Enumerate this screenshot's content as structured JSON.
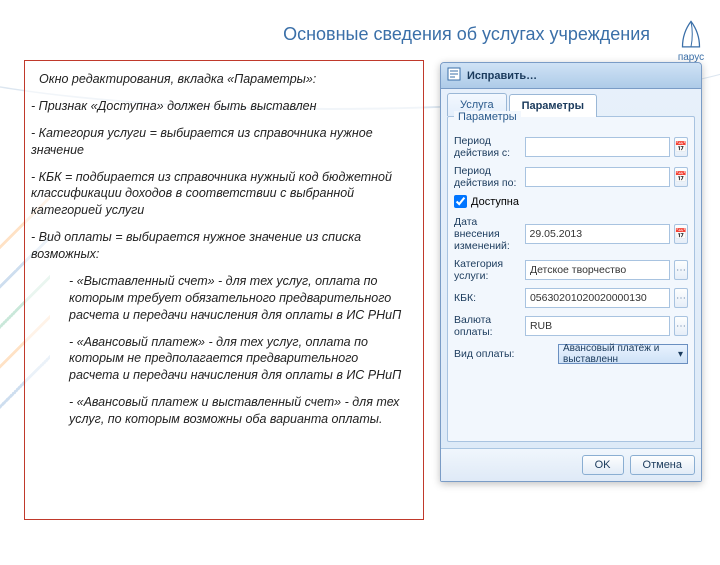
{
  "page": {
    "title": "Основные сведения об услугах учреждения"
  },
  "logo": {
    "text": "парус"
  },
  "instructions": {
    "intro": "Окно редактирования, вкладка «Параметры»:",
    "i1": "Признак «Доступна» должен быть выставлен",
    "i2": "Категория услуги = выбирается из справочника нужное значение",
    "i3": "КБК = подбирается из справочника нужный код бюджетной классификации доходов в соответствии с выбранной категорией услуги",
    "i4": "Вид оплаты = выбирается нужное значение из списка возможных:",
    "s1": "- «Выставленный счет» - для тех услуг, оплата по которым требует обязательного предварительного расчета и передачи начисления для оплаты в ИС РНиП",
    "s2": "- «Авансовый платеж» - для тех услуг, оплата по которым не предполагается предварительного расчета и передачи начисления для оплаты в ИС РНиП",
    "s3": "- «Авансовый платеж и выставленный счет» - для тех услуг, по которым возможны оба варианта оплаты."
  },
  "dialog": {
    "title": "Исправить…",
    "tabs": {
      "service": "Услуга",
      "params": "Параметры"
    },
    "legend": "Параметры",
    "labels": {
      "period_from": "Период действия с:",
      "period_to": "Период действия по:",
      "available": "Доступна",
      "change_date": "Дата внесения изменений:",
      "category": "Категория услуги:",
      "kbk": "КБК:",
      "currency": "Валюта оплаты:",
      "pay_kind": "Вид оплаты:"
    },
    "values": {
      "period_from": "",
      "period_to": "",
      "available_checked": true,
      "change_date": "29.05.2013",
      "category": "Детское творчество",
      "kbk": "05630201020020000130",
      "currency": "RUB",
      "pay_kind": "Авансовый платёж и выставленн"
    },
    "buttons": {
      "ok": "OK",
      "cancel": "Отмена"
    }
  }
}
